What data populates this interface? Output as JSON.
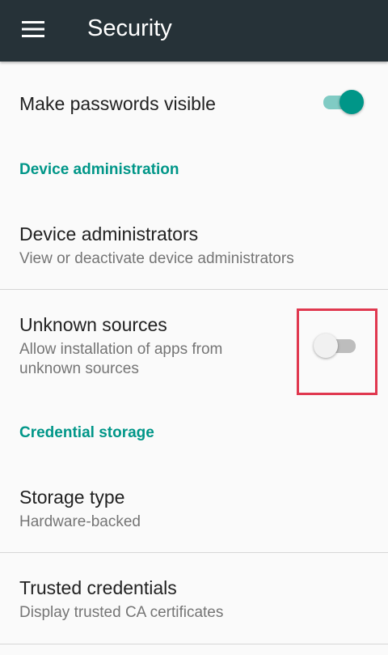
{
  "app_bar": {
    "title": "Security",
    "menu_icon": "hamburger-menu-icon",
    "background": "#263238"
  },
  "colors": {
    "accent": "#009688",
    "switch_on_track": "#80cbc4",
    "switch_off_track": "#bdbdbd",
    "switch_off_thumb": "#f1f1f1",
    "highlight": "#e0384f"
  },
  "preferences": {
    "passwords_visible": {
      "title": "Make passwords visible",
      "enabled": true
    },
    "device_admin_header": "Device administration",
    "device_administrators": {
      "title": "Device administrators",
      "summary": "View or deactivate device administrators"
    },
    "unknown_sources": {
      "title": "Unknown sources",
      "summary": "Allow installation of apps from unknown sources",
      "enabled": false
    },
    "credential_header": "Credential storage",
    "storage_type": {
      "title": "Storage type",
      "summary": "Hardware-backed"
    },
    "trusted_credentials": {
      "title": "Trusted credentials",
      "summary": "Display trusted CA certificates"
    }
  }
}
